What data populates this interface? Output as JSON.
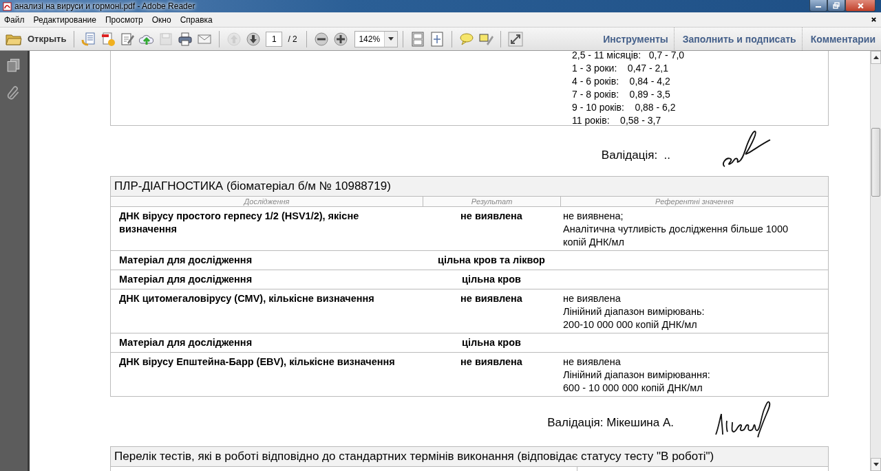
{
  "window": {
    "title": "анализі на вируси и гормоні.pdf - Adobe Reader"
  },
  "menu": [
    "Файл",
    "Редактирование",
    "Просмотр",
    "Окно",
    "Справка"
  ],
  "toolbar": {
    "open_label": "Открыть",
    "page": "1",
    "page_total": "/ 2",
    "zoom": "142%",
    "panels": [
      "Инструменты",
      "Заполнить и подписать",
      "Комментарии"
    ]
  },
  "document": {
    "reference_lines": [
      "2,5 - 11 місяців:   0,7 - 7,0",
      "1 - 3 роки:    0,47 - 2,1",
      "4 - 6 років:    0,84 - 4,2",
      "7 - 8 років:    0,89 - 3,5",
      "9 - 10 років:    0,88 - 6,2",
      "11 років:    0,58 - 3,7"
    ],
    "validation_1": "Валідація:  ..",
    "pcr_table": {
      "title": "ПЛР-ДІАГНОСТИКА  (біоматеріал б/м № 10988719)",
      "columns": [
        "Дослідження",
        "Результат",
        "Референтні значення"
      ],
      "rows": [
        {
          "kind": "test",
          "name": "ДНК вірусу простого герпесу 1/2 (HSV1/2), якісне визначення",
          "result": "не виявлена",
          "reference": [
            "не виявнена;",
            "Аналітична чутливість дослідження більше 1000 копій ДНК/мл"
          ]
        },
        {
          "kind": "material",
          "name": "Матеріал для дослідження",
          "value": "цільна кров та ліквор"
        },
        {
          "kind": "material",
          "name": "Матеріал для дослідження",
          "value": "цільна кров"
        },
        {
          "kind": "test",
          "name": "ДНК цитомегаловірусу (CMV), кількісне визначення",
          "result": "не виявлена",
          "reference": [
            "не виявлена",
            "Лінійний діапазон вимірювань:",
            "200-10 000 000 копій ДНК/мл"
          ]
        },
        {
          "kind": "material",
          "name": "Матеріал для дослідження",
          "value": "цільна кров"
        },
        {
          "kind": "test",
          "name": "ДНК вірусу Епштейна-Барр (EBV), кількісне визначення",
          "result": "не виявлена",
          "reference": [
            "не виявлена",
            "Лінійний діапазон вимірювання:",
            "600 - 10 000 000 копій ДНК/мл"
          ]
        }
      ]
    },
    "validation_2": "Валідація: Мікешина А.",
    "tests_table": {
      "title": "Перелік тестів, які в роботі відповідно до стандартних термінів виконання (відповідає статусу тесту \"В роботі\")"
    }
  }
}
